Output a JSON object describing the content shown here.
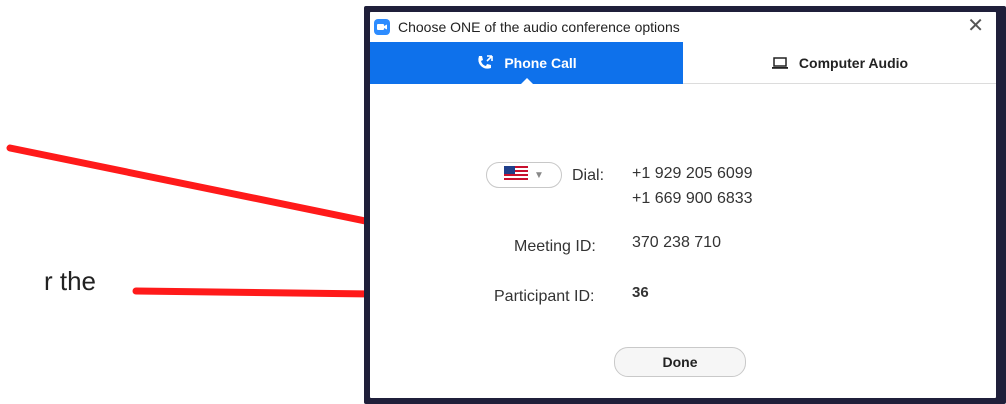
{
  "background": {
    "partial_text": "r the"
  },
  "dialog": {
    "title": "Choose ONE of the audio conference options",
    "tabs": [
      {
        "label": "Phone Call",
        "active": true,
        "icon": "phone-icon"
      },
      {
        "label": "Computer Audio",
        "active": false,
        "icon": "laptop-icon"
      }
    ],
    "dial_label": "Dial:",
    "dial_numbers": [
      "+1 929 205 6099",
      "+1 669 900 6833"
    ],
    "meeting_id_label": "Meeting ID:",
    "meeting_id": "370 238 710",
    "participant_id_label": "Participant ID:",
    "participant_id": "36",
    "done_label": "Done",
    "country": "US"
  },
  "colors": {
    "accent": "#0e71eb",
    "arrow": "#ff1a1a"
  }
}
